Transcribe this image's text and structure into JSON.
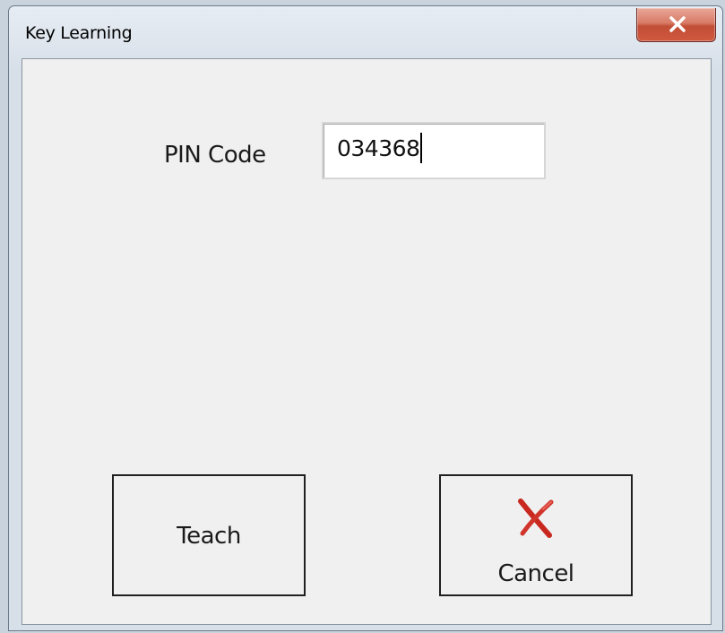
{
  "window": {
    "title": "Key Learning",
    "close_icon": "close-icon"
  },
  "form": {
    "pin_label": "PIN Code",
    "pin_value": "034368"
  },
  "buttons": {
    "teach_label": "Teach",
    "cancel_label": "Cancel",
    "cancel_icon": "red-x-icon"
  },
  "colors": {
    "close_button": "#c9503a",
    "cancel_icon": "#c8281e"
  }
}
